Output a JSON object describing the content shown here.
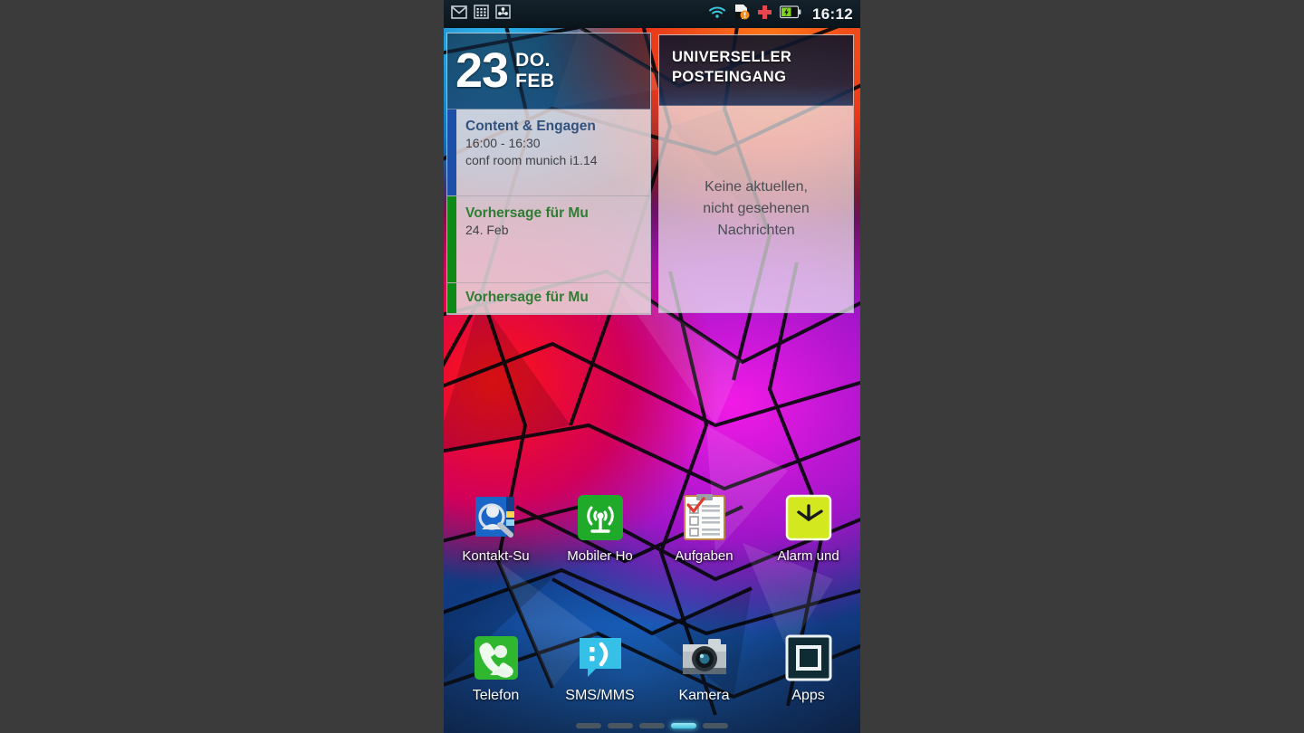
{
  "statusbar": {
    "left_icons": [
      "gmail-icon",
      "calendar-grid-icon",
      "sync-icon"
    ],
    "right_icons": [
      "wifi-icon",
      "sd-card-warning-icon",
      "red-cross-icon",
      "battery-charging-icon"
    ],
    "time": "16:12"
  },
  "calendar_widget": {
    "day_number": "23",
    "day_of_week": "DO.",
    "month": "FEB",
    "events": [
      {
        "title": "Content & Engagen",
        "line2": "16:00 - 16:30",
        "line3": "conf room munich i1.14",
        "color": "#1b4fa8"
      },
      {
        "title": "Vorhersage für Mu",
        "line2": "24. Feb",
        "line3": "",
        "color": "#0d8a16"
      },
      {
        "title": "Vorhersage für Mu",
        "line2": "",
        "line3": "",
        "color": "#0d8a16"
      }
    ]
  },
  "inbox_widget": {
    "title": "UNIVERSELLER\nPOSTEINGANG",
    "empty_message": "Keine aktuellen,\nnicht gesehenen\nNachrichten"
  },
  "app_row": [
    {
      "label": "Kontakt-Su",
      "icon": "contact-search-icon"
    },
    {
      "label": "Mobiler Ho",
      "icon": "mobile-hotspot-icon"
    },
    {
      "label": "Aufgaben",
      "icon": "tasks-clipboard-icon"
    },
    {
      "label": "Alarm und",
      "icon": "alarm-clock-icon"
    }
  ],
  "dock": [
    {
      "label": "Telefon",
      "icon": "phone-icon"
    },
    {
      "label": "SMS/MMS",
      "icon": "message-bubble-icon"
    },
    {
      "label": "Kamera",
      "icon": "camera-icon"
    },
    {
      "label": "Apps",
      "icon": "app-drawer-icon"
    }
  ],
  "page_indicator": {
    "count": 5,
    "active_index": 3
  },
  "colors": {
    "accent_cyan": "#3fc4dd",
    "event_blue": "#1b4fa8",
    "event_green": "#0d8a16",
    "hotspot_green": "#1faa2a",
    "sms_cyan": "#35c0e8",
    "phone_green": "#2fb72f",
    "alarm_yellow": "#d4e820"
  }
}
